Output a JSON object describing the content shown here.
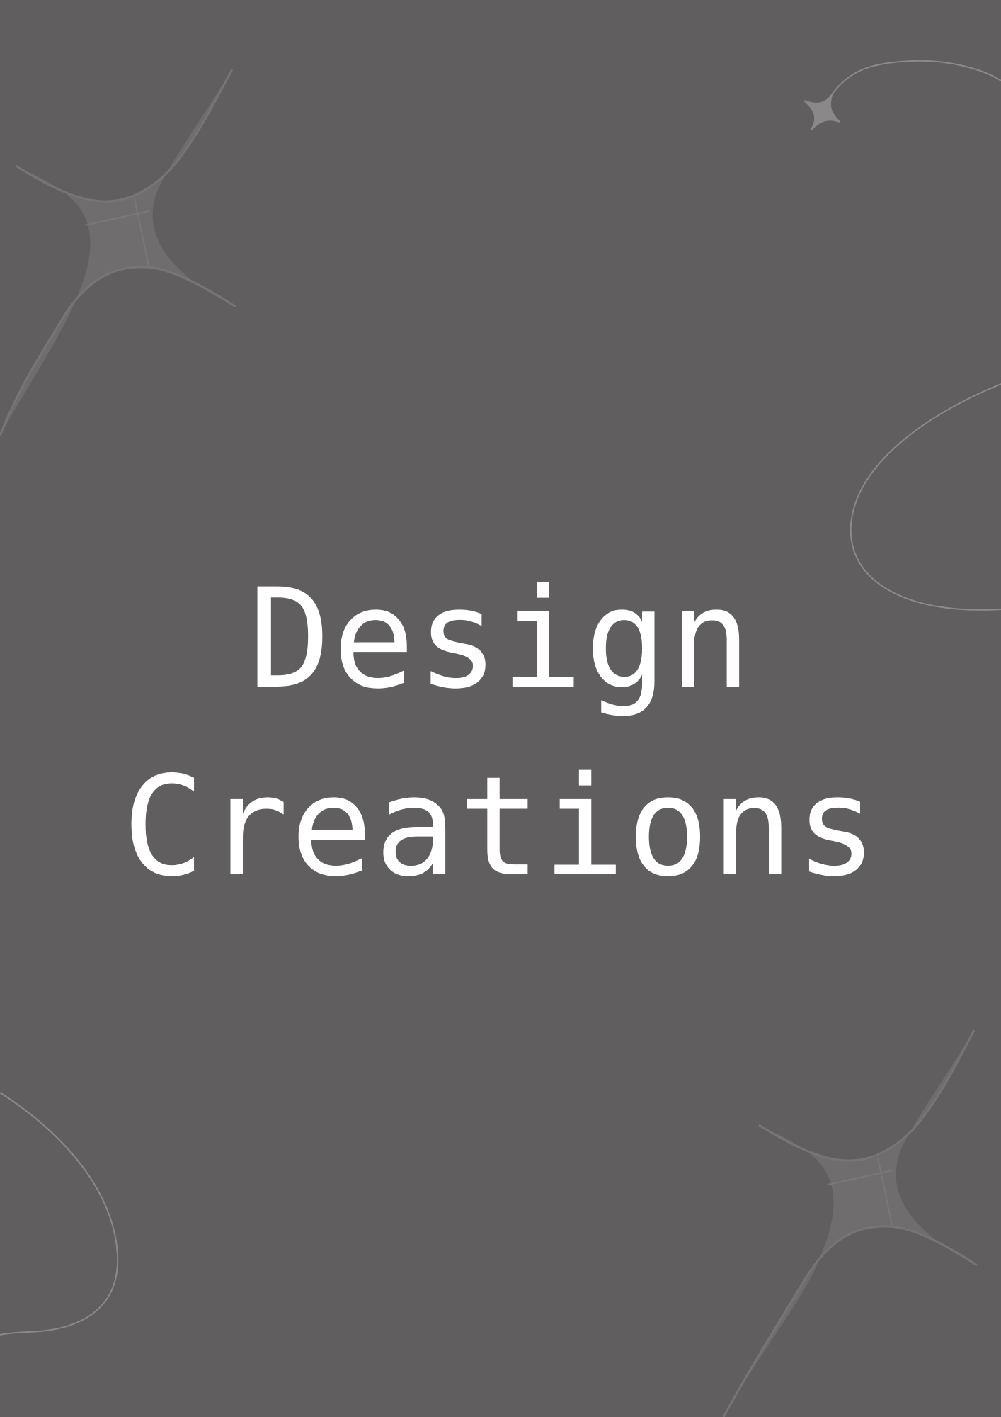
{
  "cover": {
    "title_line_1": "Design",
    "title_line_2": "Creations"
  },
  "colors": {
    "background": "#605e5f",
    "title": "#ffffff",
    "sparkle_fill": "#6f6d6e",
    "sparkle_line": "#777576",
    "swirl_line": "#8c8a8b"
  },
  "decorations": {
    "icons": [
      "sparkle-icon",
      "small-sparkle-icon",
      "swirl-line"
    ]
  }
}
